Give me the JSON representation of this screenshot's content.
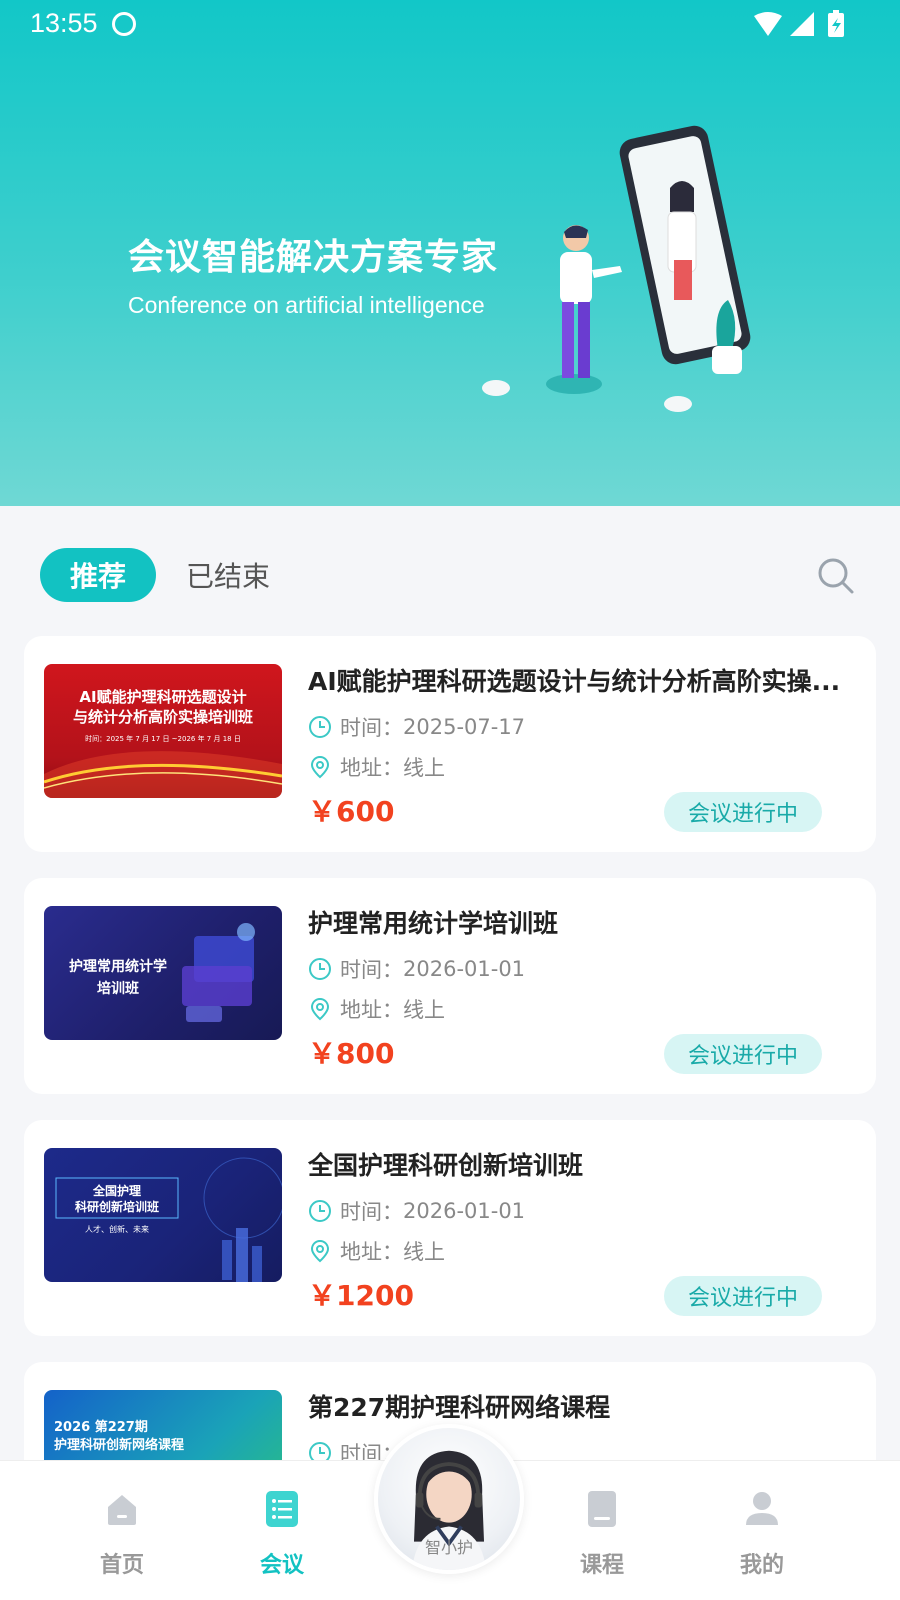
{
  "status_bar": {
    "time": "13:55"
  },
  "banner": {
    "title": "会议智能解决方案专家",
    "subtitle": "Conference on artificial intelligence"
  },
  "tabs": {
    "active": "推荐",
    "inactive": "已结束"
  },
  "cards": [
    {
      "thumb_line1": "AI赋能护理科研选题设计",
      "thumb_line2": "与统计分析高阶实操培训班",
      "thumb_line3": "时间：2025 年 7 月 17 日 ~2026 年 7 月 18 日",
      "title": "AI赋能护理科研选题设计与统计分析高阶实操...",
      "time_label": "时间：",
      "time": "2025-07-17",
      "addr_label": "地址：",
      "addr": "线上",
      "price": "￥600",
      "status": "会议进行中"
    },
    {
      "thumb_line1": "护理常用统计学",
      "thumb_line2": "培训班",
      "title": "护理常用统计学培训班",
      "time_label": "时间：",
      "time": "2026-01-01",
      "addr_label": "地址：",
      "addr": "线上",
      "price": "￥800",
      "status": "会议进行中"
    },
    {
      "thumb_line1": "全国护理",
      "thumb_line2": "科研创新培训班",
      "thumb_line3": "人才、创新、未来",
      "title": "全国护理科研创新培训班",
      "time_label": "时间：",
      "time": "2026-01-01",
      "addr_label": "地址：",
      "addr": "线上",
      "price": "￥1200",
      "status": "会议进行中"
    },
    {
      "thumb_line1": "2026 第227期",
      "thumb_line2": "护理科研创新网络课程",
      "title": "第227期护理科研网络课程",
      "time_label": "时间："
    }
  ],
  "bottom_nav": {
    "home": "首页",
    "meeting": "会议",
    "assistant": "智小护",
    "course": "课程",
    "mine": "我的"
  },
  "colors": {
    "accent": "#12c2c2",
    "price": "#f2421f",
    "badge_bg": "#d7f5f4"
  }
}
